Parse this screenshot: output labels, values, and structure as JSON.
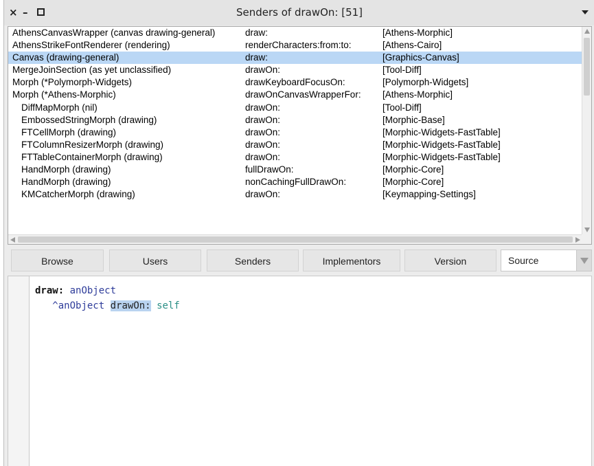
{
  "window": {
    "title": "Senders of drawOn: [51]",
    "controls": {
      "close": "×",
      "minimize": "–"
    }
  },
  "senders": [
    {
      "class": "AthensCanvasWrapper (canvas drawing-general)",
      "selector": "draw:",
      "package": "[Athens-Morphic]",
      "indent": false,
      "selected": false
    },
    {
      "class": "AthensStrikeFontRenderer (rendering)",
      "selector": "renderCharacters:from:to:",
      "package": "[Athens-Cairo]",
      "indent": false,
      "selected": false
    },
    {
      "class": "Canvas (drawing-general)",
      "selector": "draw:",
      "package": "[Graphics-Canvas]",
      "indent": false,
      "selected": true
    },
    {
      "class": "MergeJoinSection (as yet unclassified)",
      "selector": "drawOn:",
      "package": "[Tool-Diff]",
      "indent": false,
      "selected": false
    },
    {
      "class": "Morph (*Polymorph-Widgets)",
      "selector": "drawKeyboardFocusOn:",
      "package": "[Polymorph-Widgets]",
      "indent": false,
      "selected": false
    },
    {
      "class": "Morph (*Athens-Morphic)",
      "selector": "drawOnCanvasWrapperFor:",
      "package": "[Athens-Morphic]",
      "indent": false,
      "selected": false
    },
    {
      "class": "DiffMapMorph (nil)",
      "selector": "drawOn:",
      "package": "[Tool-Diff]",
      "indent": true,
      "selected": false
    },
    {
      "class": "EmbossedStringMorph (drawing)",
      "selector": "drawOn:",
      "package": "[Morphic-Base]",
      "indent": true,
      "selected": false
    },
    {
      "class": "FTCellMorph (drawing)",
      "selector": "drawOn:",
      "package": "[Morphic-Widgets-FastTable]",
      "indent": true,
      "selected": false
    },
    {
      "class": "FTColumnResizerMorph (drawing)",
      "selector": "drawOn:",
      "package": "[Morphic-Widgets-FastTable]",
      "indent": true,
      "selected": false
    },
    {
      "class": "FTTableContainerMorph (drawing)",
      "selector": "drawOn:",
      "package": "[Morphic-Widgets-FastTable]",
      "indent": true,
      "selected": false
    },
    {
      "class": "HandMorph (drawing)",
      "selector": "fullDrawOn:",
      "package": "[Morphic-Core]",
      "indent": true,
      "selected": false
    },
    {
      "class": "HandMorph (drawing)",
      "selector": "nonCachingFullDrawOn:",
      "package": "[Morphic-Core]",
      "indent": true,
      "selected": false
    },
    {
      "class": "KMCatcherMorph (drawing)",
      "selector": "drawOn:",
      "package": "[Keymapping-Settings]",
      "indent": true,
      "selected": false
    }
  ],
  "toolbar": {
    "browse": "Browse",
    "users": "Users",
    "senders": "Senders",
    "implementors": "Implementors",
    "version": "Version",
    "source": "Source"
  },
  "code": {
    "selector": "draw:",
    "argument": "anObject",
    "return_caret": "^",
    "receiver": "anObject",
    "message": "drawOn:",
    "self": "self"
  },
  "colors": {
    "selection": "#bad7f5",
    "code_argument": "#2e3c9a",
    "code_self": "#2b8f86",
    "code_highlight": "#b9d3f0"
  }
}
